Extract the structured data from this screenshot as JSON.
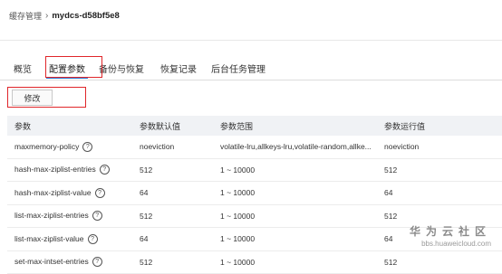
{
  "breadcrumb": {
    "parent": "缓存管理",
    "separator": "›",
    "current": "mydcs-d58bf5e8"
  },
  "tabs": [
    {
      "label": "概览",
      "active": false
    },
    {
      "label": "配置参数",
      "active": true
    },
    {
      "label": "备份与恢复",
      "active": false
    },
    {
      "label": "恢复记录",
      "active": false
    },
    {
      "label": "后台任务管理",
      "active": false
    }
  ],
  "toolbar": {
    "modify_label": "修改"
  },
  "table": {
    "headers": [
      "参数",
      "参数默认值",
      "参数范围",
      "参数运行值"
    ],
    "rows": [
      {
        "name": "maxmemory-policy",
        "default": "noeviction",
        "range": "volatile-lru,allkeys-lru,volatile-random,allke...",
        "running": "noeviction"
      },
      {
        "name": "hash-max-ziplist-entries",
        "default": "512",
        "range": "1 ~ 10000",
        "running": "512"
      },
      {
        "name": "hash-max-ziplist-value",
        "default": "64",
        "range": "1 ~ 10000",
        "running": "64"
      },
      {
        "name": "list-max-ziplist-entries",
        "default": "512",
        "range": "1 ~ 10000",
        "running": "512"
      },
      {
        "name": "list-max-ziplist-value",
        "default": "64",
        "range": "1 ~ 10000",
        "running": "64"
      },
      {
        "name": "set-max-intset-entries",
        "default": "512",
        "range": "1 ~ 10000",
        "running": "512"
      }
    ],
    "help_icon": "?"
  },
  "watermark": {
    "title": "华为云社区",
    "url": "bbs.huaweicloud.com"
  },
  "colors": {
    "accent": "#2a7ad5",
    "highlight": "#e0262a",
    "header_bg": "#f0f2f5"
  }
}
